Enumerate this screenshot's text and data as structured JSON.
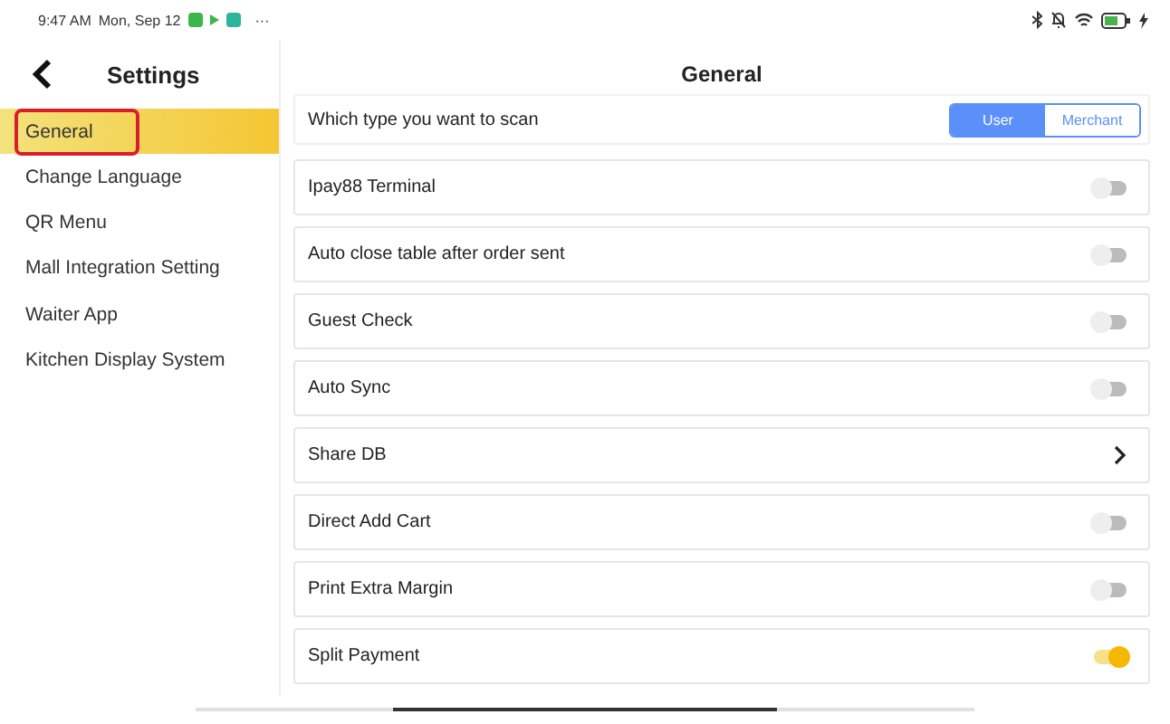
{
  "status_bar": {
    "time": "9:47 AM",
    "date": "Mon, Sep 12",
    "more": "···"
  },
  "sidebar": {
    "title": "Settings",
    "items": [
      {
        "label": "General",
        "selected": true
      },
      {
        "label": "Change Language",
        "selected": false
      },
      {
        "label": "QR Menu",
        "selected": false
      },
      {
        "label": "Mall Integration Setting",
        "selected": false
      },
      {
        "label": "Waiter App",
        "selected": false
      },
      {
        "label": "Kitchen Display System",
        "selected": false
      }
    ]
  },
  "content": {
    "title": "General",
    "rows": [
      {
        "kind": "segmented",
        "label": "Which type you want to scan",
        "options": [
          {
            "label": "User",
            "selected": true
          },
          {
            "label": "Merchant",
            "selected": false
          }
        ]
      },
      {
        "kind": "toggle",
        "label": "Ipay88 Terminal",
        "on": false
      },
      {
        "kind": "toggle",
        "label": "Auto close table after order sent",
        "on": false
      },
      {
        "kind": "toggle",
        "label": "Guest Check",
        "on": false
      },
      {
        "kind": "toggle",
        "label": "Auto Sync",
        "on": false
      },
      {
        "kind": "link",
        "label": "Share DB"
      },
      {
        "kind": "toggle",
        "label": "Direct Add Cart",
        "on": false
      },
      {
        "kind": "toggle",
        "label": "Print Extra Margin",
        "on": false
      },
      {
        "kind": "toggle",
        "label": "Split Payment",
        "on": true
      }
    ]
  }
}
